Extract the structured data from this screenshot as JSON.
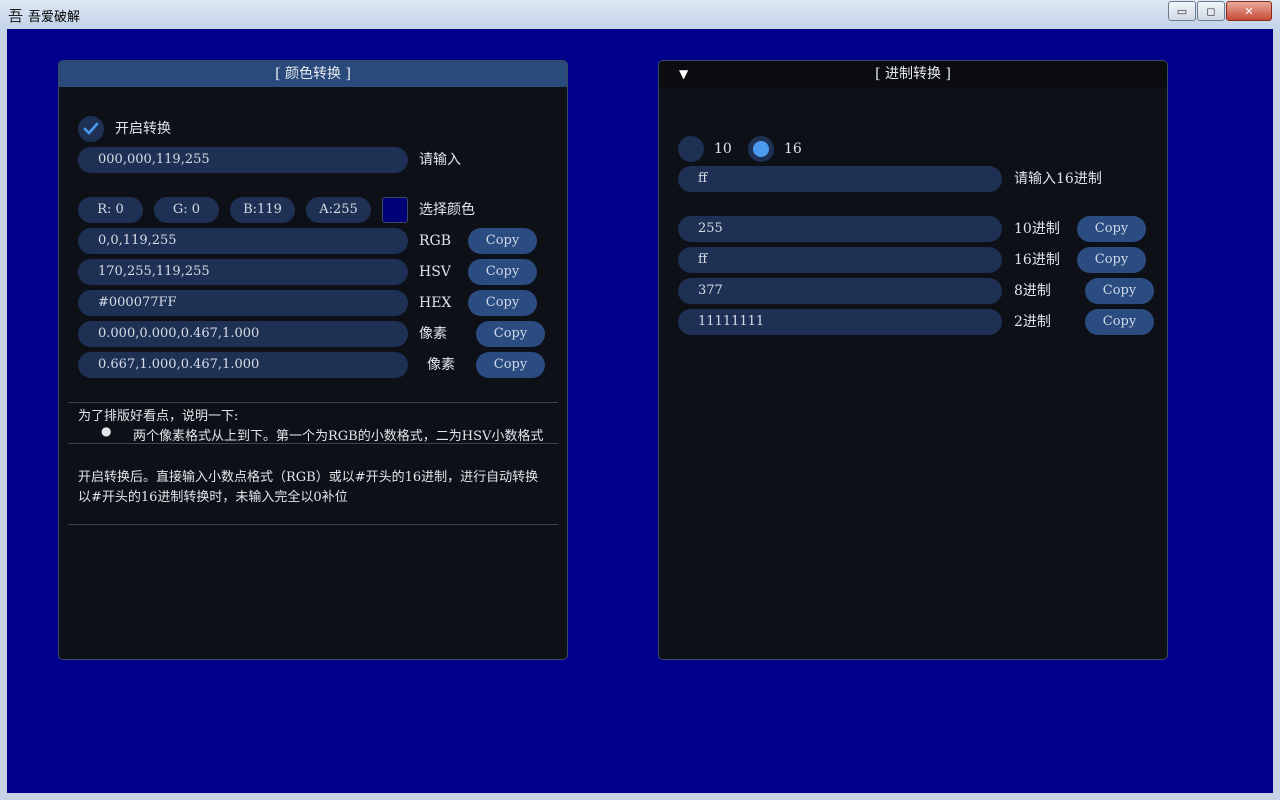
{
  "window": {
    "icon": "吾",
    "title": "吾爱破解",
    "minimize_label": "▭",
    "maximize_label": "◻",
    "close_label": "✕"
  },
  "colors": {
    "background": "#00008A",
    "panel": "#0E1018",
    "field": "#1E3154",
    "button": "#2A4C80",
    "header_active": "#2A4A7C",
    "radio_selected": "#4A9AF0",
    "swatch": "#000077"
  },
  "color_panel": {
    "title": "[ 颜色转换 ]",
    "enable_checked": true,
    "enable_label": "开启转换",
    "input_value": "000,000,119,255",
    "input_label": "请输入",
    "channels": [
      "R:  0",
      "G:  0",
      "B:119",
      "A:255"
    ],
    "pick_color_label": "选择颜色",
    "rows": [
      {
        "value": "0,0,119,255",
        "label": "RGB",
        "button": "Copy"
      },
      {
        "value": "170,255,119,255",
        "label": "HSV",
        "button": "Copy"
      },
      {
        "value": "#000077FF",
        "label": "HEX",
        "button": "Copy"
      },
      {
        "value": "0.000,0.000,0.467,1.000",
        "label": "像素",
        "button": "Copy"
      },
      {
        "value": "0.667,1.000,0.467,1.000",
        "label": "像素",
        "button": "Copy"
      }
    ],
    "note_heading": "为了排版好看点，说明一下:",
    "note_bullet": "两个像素格式从上到下。第一个为RGB的小数格式，二为HSV小数格式",
    "note_line1": "开启转换后。直接输入小数点格式（RGB）或以#开头的16进制，进行自动转换",
    "note_line2": "以#开头的16进制转换时，未输入完全以0补位"
  },
  "base_panel": {
    "title": "[ 进制转换 ]",
    "collapse_icon": "▼",
    "radio_options": [
      "10",
      "16"
    ],
    "selected_radio": "16",
    "input_value": "ff",
    "input_label": "请输入16进制",
    "rows": [
      {
        "value": "255",
        "label": "10进制",
        "button": "Copy"
      },
      {
        "value": "ff",
        "label": "16进制",
        "button": "Copy"
      },
      {
        "value": "377",
        "label": "8进制",
        "button": "Copy"
      },
      {
        "value": "11111111",
        "label": "2进制",
        "button": "Copy"
      }
    ]
  }
}
